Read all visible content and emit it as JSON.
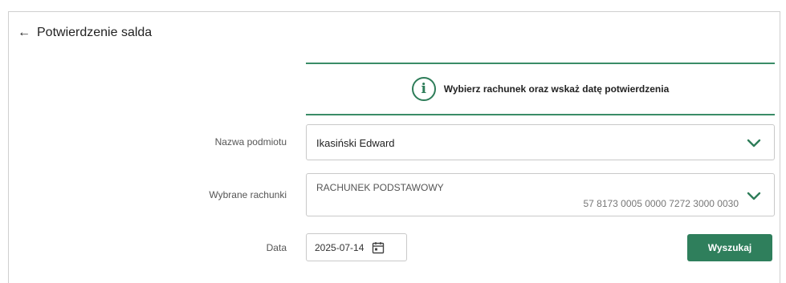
{
  "header": {
    "back_label": "Potwierdzenie salda"
  },
  "info": {
    "message": "Wybierz rachunek oraz wskaż datę potwierdzenia",
    "icon": "info-icon",
    "accent": "#2e7d59"
  },
  "form": {
    "entity_label": "Nazwa podmiotu",
    "entity_value": "Ikasiński Edward",
    "accounts_label": "Wybrane rachunki",
    "account_name": "RACHUNEK PODSTAWOWY",
    "account_number": "57 8173 0005 0000 7272 3000 0030",
    "date_label": "Data",
    "date_value": "2025-07-14"
  },
  "actions": {
    "search_label": "Wyszukaj",
    "button_color": "#2f7f5c"
  }
}
